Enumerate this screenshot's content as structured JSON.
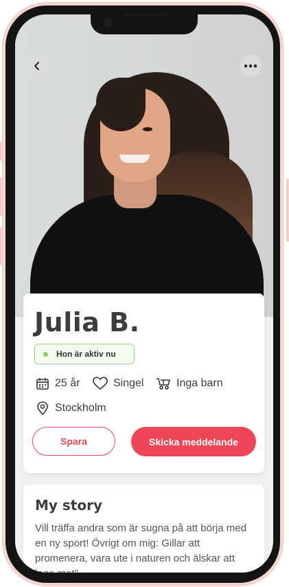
{
  "profile": {
    "name": "Julia B.",
    "status": "Hon är aktiv nu",
    "facts": {
      "age": "25 år",
      "relationship": "Singel",
      "children": "Inga barn",
      "location": "Stockholm"
    }
  },
  "actions": {
    "save_label": "Spara",
    "message_label": "Skicka meddelande"
  },
  "story": {
    "title": "My story",
    "text": "Vill träffa andra som är sugna på att börja med en ny sport! Övrigt om mig: Gillar att promenera, vara ute i naturen och älskar att laga mat\""
  },
  "icons": {
    "back": "chevron-left-icon",
    "more": "more-dots-icon",
    "age": "calendar-icon",
    "relationship": "heart-icon",
    "children": "stroller-icon",
    "location": "location-pin-icon"
  },
  "colors": {
    "accent": "#ef4657",
    "active": "#8bd165",
    "active_border": "#9fd58a",
    "text": "#3d3d3d"
  }
}
